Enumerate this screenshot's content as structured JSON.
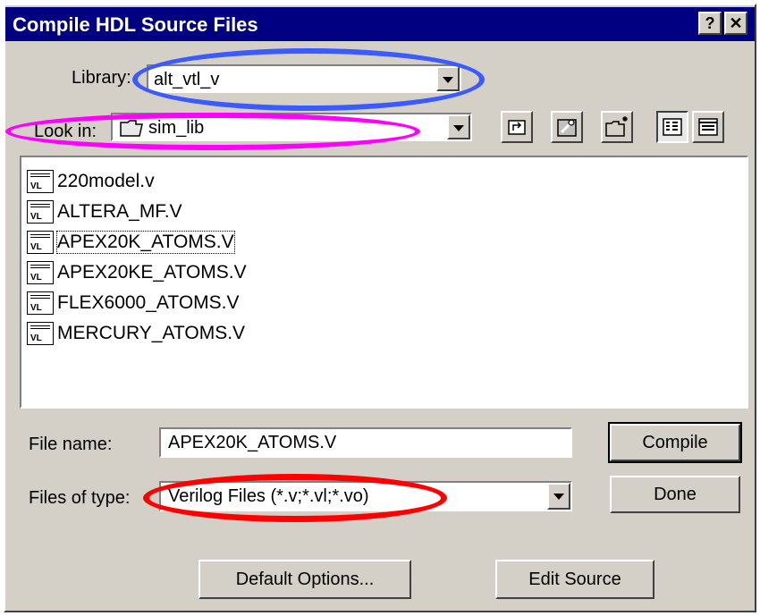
{
  "window": {
    "title": "Compile HDL Source Files",
    "help_glyph": "?",
    "close_glyph": "✕"
  },
  "library": {
    "label": "Library:",
    "value": "alt_vtl_v"
  },
  "look_in": {
    "label": "Look in:",
    "value": "sim_lib",
    "folder_icon": "folder-icon"
  },
  "toolbar": {
    "icons": [
      "up-folder-icon",
      "library-icon",
      "new-folder-icon",
      "list-view-icon",
      "details-view-icon"
    ]
  },
  "files": [
    {
      "name": "220model.v",
      "icon": "VL",
      "selected": false
    },
    {
      "name": "ALTERA_MF.V",
      "icon": "VL",
      "selected": false
    },
    {
      "name": "APEX20K_ATOMS.V",
      "icon": "VL",
      "selected": true
    },
    {
      "name": "APEX20KE_ATOMS.V",
      "icon": "VL",
      "selected": false
    },
    {
      "name": "FLEX6000_ATOMS.V",
      "icon": "VL",
      "selected": false
    },
    {
      "name": "MERCURY_ATOMS.V",
      "icon": "VL",
      "selected": false
    }
  ],
  "file_name": {
    "label": "File name:",
    "value": "APEX20K_ATOMS.V"
  },
  "file_type": {
    "label": "Files of type:",
    "value": "Verilog Files (*.v;*.vl;*.vo)"
  },
  "buttons": {
    "compile": "Compile",
    "done": "Done",
    "default_options": "Default Options...",
    "edit_source": "Edit Source"
  },
  "annotation_colors": {
    "library": "#3b5bff",
    "look_in": "#ff00ff",
    "file_type": "#ff0000"
  }
}
